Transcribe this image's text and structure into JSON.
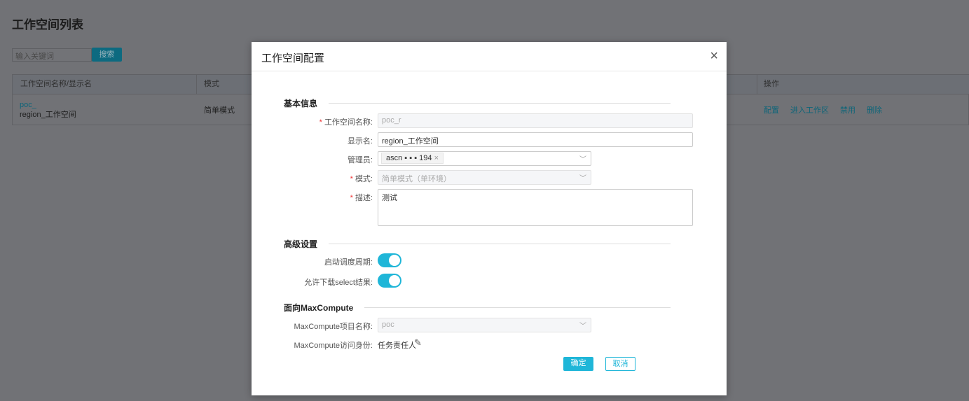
{
  "page": {
    "title": "工作空间列表",
    "search_placeholder": "输入关键词",
    "search_button": "搜索",
    "columns": [
      "工作空间名称/显示名",
      "模式",
      "操作"
    ],
    "row": {
      "name": "poc_",
      "display": "region_工作空间",
      "mode": "简单模式",
      "actions": [
        "配置",
        "进入工作区",
        "禁用",
        "删除"
      ]
    }
  },
  "modal": {
    "title": "工作空间配置",
    "close": "×",
    "basic_section": "基本信息",
    "fields": {
      "name": {
        "label": "工作空间名称:",
        "value": "poc_r"
      },
      "display": {
        "label": "显示名:",
        "value": "region_工作空间"
      },
      "admin": {
        "label": "管理员:",
        "tag": "ascn ▪ ▪ ▪ 194",
        "remove": "×"
      },
      "mode": {
        "label": "模式:",
        "value": "简单模式（单环境）"
      },
      "desc": {
        "label": "描述:",
        "value": "测试"
      }
    },
    "advanced_section": "高级设置",
    "schedule": {
      "label": "启动调度周期:",
      "on": true
    },
    "download": {
      "label": "允许下载select结果:",
      "on": true
    },
    "mc_section": "面向MaxCompute",
    "mc_project": {
      "label": "MaxCompute项目名称:",
      "value": "poc"
    },
    "mc_identity": {
      "label": "MaxCompute访问身份:",
      "value": "任务责任人"
    },
    "ok": "确定",
    "cancel": "取消"
  },
  "colors": {
    "accent": "#1fb6d8"
  }
}
